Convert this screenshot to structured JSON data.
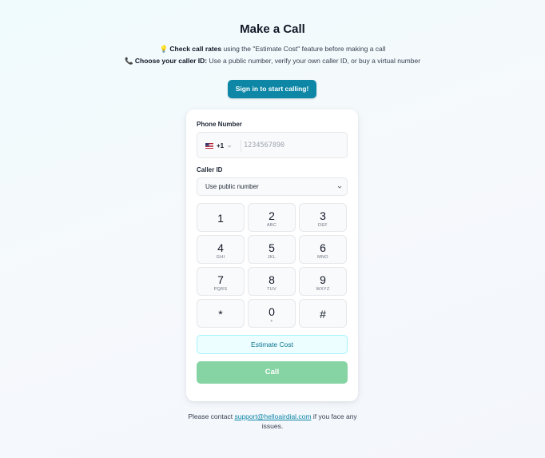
{
  "header": {
    "title": "Make a Call",
    "info1": {
      "emoji": "💡",
      "bold": "Check call rates",
      "text": " using the \"Estimate Cost\" feature before making a call"
    },
    "info2": {
      "emoji": "📞",
      "bold": "Choose your caller ID:",
      "text": " Use a public number, verify your own caller ID, or buy a virtual number"
    },
    "signin_label": "Sign in to start calling!"
  },
  "form": {
    "phone_label": "Phone Number",
    "country_code": "+1",
    "flag_icon": "us-flag-icon",
    "phone_placeholder": "1234567890",
    "caller_label": "Caller ID",
    "caller_value": "Use public number"
  },
  "keypad": [
    {
      "digit": "1",
      "letters": ""
    },
    {
      "digit": "2",
      "letters": "ABC"
    },
    {
      "digit": "3",
      "letters": "DEF"
    },
    {
      "digit": "4",
      "letters": "GHI"
    },
    {
      "digit": "5",
      "letters": "JKL"
    },
    {
      "digit": "6",
      "letters": "MNO"
    },
    {
      "digit": "7",
      "letters": "PQRS"
    },
    {
      "digit": "8",
      "letters": "TUV"
    },
    {
      "digit": "9",
      "letters": "WXYZ"
    },
    {
      "digit": "*",
      "letters": ""
    },
    {
      "digit": "0",
      "letters": "+"
    },
    {
      "digit": "#",
      "letters": ""
    }
  ],
  "actions": {
    "estimate_label": "Estimate Cost",
    "call_label": "Call"
  },
  "footer": {
    "before": "Please contact ",
    "email": "support@helloairdial.com",
    "after": " if you face any issues."
  },
  "colors": {
    "accent": "#0e87a7",
    "call_button": "#86d4a3",
    "estimate_bg": "#ecfeff"
  }
}
